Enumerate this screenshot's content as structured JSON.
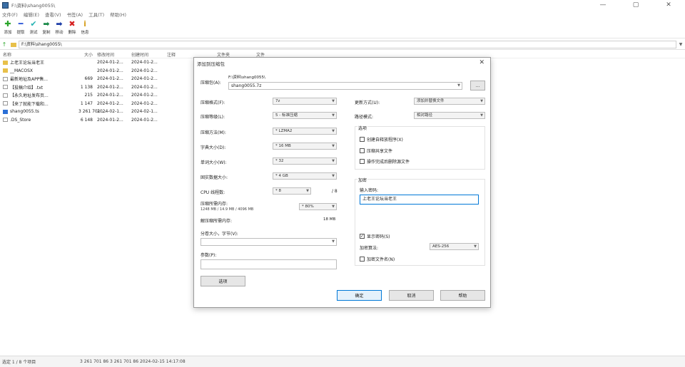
{
  "window": {
    "title": "F:\\资料\\shang0055\\",
    "min": "—",
    "max": "▢",
    "close": "✕"
  },
  "menu": [
    "文件(F)",
    "编辑(E)",
    "查看(V)",
    "书签(A)",
    "工具(T)",
    "帮助(H)"
  ],
  "toolbar": [
    {
      "label": "添加",
      "icon": "✚",
      "color": "#2aa52a"
    },
    {
      "label": "提取",
      "icon": "━",
      "color": "#2b56d6"
    },
    {
      "label": "测试",
      "icon": "✔",
      "color": "#26b3b3"
    },
    {
      "label": "复制",
      "icon": "➡",
      "color": "#1b8a4a"
    },
    {
      "label": "移动",
      "icon": "➡",
      "color": "#1f3fa8"
    },
    {
      "label": "删除",
      "icon": "✖",
      "color": "#d62020"
    },
    {
      "label": "信息",
      "icon": "i",
      "color": "#d6a020"
    }
  ],
  "path": "F:\\资料\\shang0055\\",
  "columns": [
    "名称",
    "大小",
    "修改时间",
    "创建时间",
    "注释",
    "文件夹",
    "文件"
  ],
  "files": [
    {
      "name": "上老王论坛当老王",
      "size": "",
      "modified": "2024-01-2...",
      "created": "2024-01-2...",
      "type": "folder"
    },
    {
      "name": "__MACOSX",
      "size": "",
      "modified": "2024-01-2...",
      "created": "2024-01-2...",
      "type": "folder"
    },
    {
      "name": "最新地址及APP售...",
      "size": "669",
      "modified": "2024-01-2...",
      "created": "2024-01-2...",
      "type": "doc"
    },
    {
      "name": "【投稿介绍】.txt",
      "size": "1 138",
      "modified": "2024-01-2...",
      "created": "2024-01-2...",
      "type": "doc"
    },
    {
      "name": "【永久地址发布页...",
      "size": "215",
      "modified": "2024-01-2...",
      "created": "2024-01-2...",
      "type": "doc"
    },
    {
      "name": "【来了就能下载和...",
      "size": "1 147",
      "modified": "2024-01-2...",
      "created": "2024-01-2...",
      "type": "doc"
    },
    {
      "name": "shang0055.ts",
      "size": "3 261 701 ...",
      "modified": "2024-02-1...",
      "created": "2024-02-1...",
      "type": "app"
    },
    {
      "name": ".DS_Store",
      "size": "6 148",
      "modified": "2024-01-2...",
      "created": "2024-01-2...",
      "type": "doc"
    }
  ],
  "status": {
    "selected": "选定 1 / 8 个项目",
    "info": "3 261 701 86 3 261 701 86 2024-02-15 14:17:08"
  },
  "dialog": {
    "title": "添加到压缩包",
    "archive_label": "压缩包(A):",
    "archive_dir": "F:\\资料\\shang0055\\",
    "archive_name": "shang0055.7z",
    "browse": "...",
    "format_label": "压缩格式(F):",
    "format_value": "7z",
    "level_label": "压缩等级(L):",
    "level_value": "5 - 标准压缩",
    "method_label": "压缩方法(M):",
    "method_value": "* LZMA2",
    "dict_label": "字典大小(D):",
    "dict_value": "* 16 MB",
    "word_label": "单词大小(W):",
    "word_value": "* 32",
    "solid_label": "固实数据大小:",
    "solid_value": "* 4 GB",
    "cpu_label": "CPU 线程数:",
    "cpu_value": "* 8",
    "cpu_total": "/ 8",
    "mem_label": "压缩所需内存:",
    "mem_detail": "1248 MB / 14.9 MB / 4096 MB",
    "mem_value": "* 80%",
    "decmem_label": "解压缩所需内存:",
    "decmem_value": "18 MB",
    "split_label": "分卷大小，字节(V):",
    "params_label": "参数(P):",
    "options_btn": "选项",
    "update_label": "更新方式(U):",
    "update_value": "添加并替换文件",
    "pathmode_label": "路径模式:",
    "pathmode_value": "相对路径",
    "options_group": "选项",
    "opt_sfx": "创建自释放程序(X)",
    "opt_shared": "压缩共享文件",
    "opt_delete": "操作完成后删除源文件",
    "enc_group": "加密",
    "pwd_label": "输入密码:",
    "pwd_value": "上老王论坛当老王",
    "show_pwd": "显示密码(S)",
    "enc_method_label": "加密算法:",
    "enc_method_value": "AES-256",
    "enc_names": "加密文件名(N)",
    "ok": "确定",
    "cancel": "取消",
    "help": "帮助"
  }
}
